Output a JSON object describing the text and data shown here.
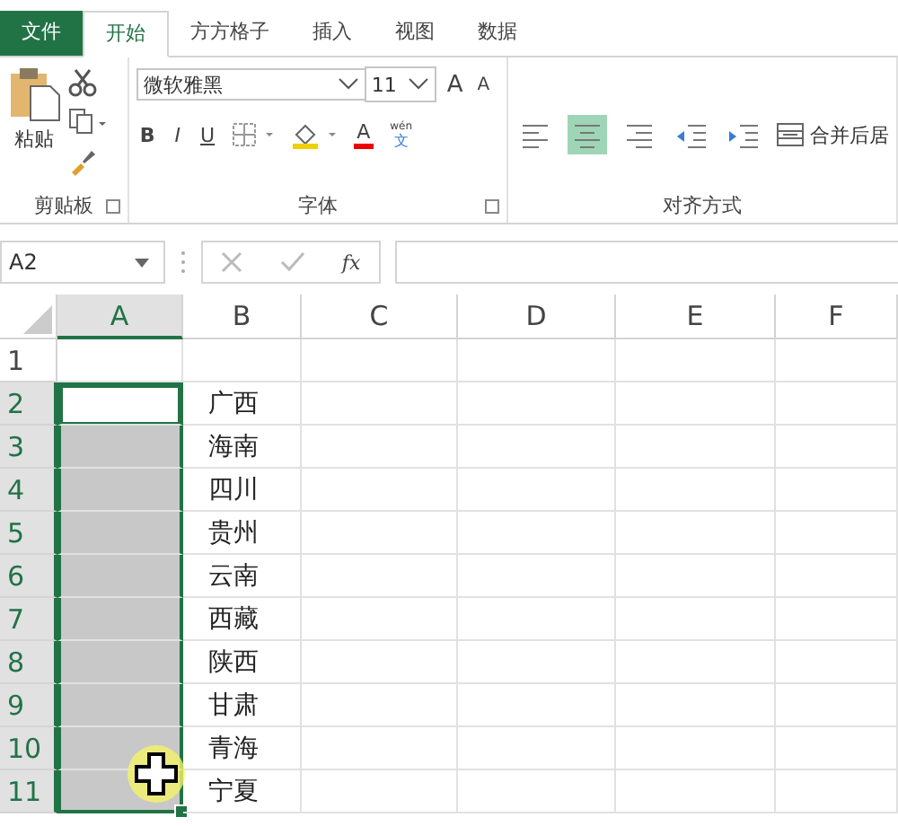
{
  "tabs": [
    {
      "label": "文件",
      "kind": "file",
      "selected": false
    },
    {
      "label": "开始",
      "kind": "tab",
      "selected": true
    },
    {
      "label": "方方格子",
      "kind": "tab",
      "selected": false
    },
    {
      "label": "插入",
      "kind": "tab",
      "selected": false
    },
    {
      "label": "视图",
      "kind": "tab",
      "selected": false
    },
    {
      "label": "数据",
      "kind": "tab",
      "selected": false
    }
  ],
  "ribbon": {
    "clipboard": {
      "paste_label": "粘贴",
      "group_label": "剪贴板"
    },
    "font": {
      "font_name": "微软雅黑",
      "font_size": "11",
      "grow": "A",
      "shrink": "A",
      "bold": "B",
      "italic": "I",
      "underline": "U",
      "font_color": "A",
      "phonetic": "wén",
      "phonetic_char": "文",
      "group_label": "字体"
    },
    "alignment": {
      "buttons": [
        {
          "kind": "left",
          "selected": false
        },
        {
          "kind": "center",
          "selected": true
        },
        {
          "kind": "right",
          "selected": false
        }
      ],
      "merge_label": "合并后居",
      "group_label": "对齐方式"
    }
  },
  "formula_bar": {
    "name_box": "A2",
    "fx": "fx"
  },
  "sheet": {
    "columns": [
      {
        "label": "A",
        "selected": true
      },
      {
        "label": "B",
        "selected": false
      },
      {
        "label": "C",
        "selected": false
      },
      {
        "label": "D",
        "selected": false
      },
      {
        "label": "E",
        "selected": false
      },
      {
        "label": "F",
        "selected": false
      }
    ],
    "rows": [
      {
        "number": "1",
        "selected": false,
        "active": false
      },
      {
        "number": "2",
        "selected": true,
        "active": true,
        "b": "广西"
      },
      {
        "number": "3",
        "selected": true,
        "active": false,
        "b": "海南"
      },
      {
        "number": "4",
        "selected": true,
        "active": false,
        "b": "四川"
      },
      {
        "number": "5",
        "selected": true,
        "active": false,
        "b": "贵州"
      },
      {
        "number": "6",
        "selected": true,
        "active": false,
        "b": "云南"
      },
      {
        "number": "7",
        "selected": true,
        "active": false,
        "b": "西藏"
      },
      {
        "number": "8",
        "selected": true,
        "active": false,
        "b": "陕西"
      },
      {
        "number": "9",
        "selected": true,
        "active": false,
        "b": "甘肃"
      },
      {
        "number": "10",
        "selected": true,
        "active": false,
        "b": "青海"
      },
      {
        "number": "11",
        "selected": true,
        "active": false,
        "b": "宁夏"
      }
    ]
  }
}
